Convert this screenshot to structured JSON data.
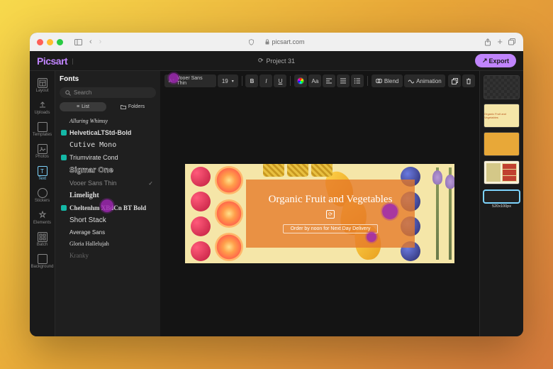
{
  "browser": {
    "url": "picsart.com"
  },
  "app": {
    "logo": "Picsart",
    "project_name": "Project 31",
    "export_label": "Export"
  },
  "rail": {
    "items": [
      {
        "label": "Layout"
      },
      {
        "label": "Uploads"
      },
      {
        "label": "Templates"
      },
      {
        "label": "Photos"
      },
      {
        "label": "Text"
      },
      {
        "label": "Stickers"
      },
      {
        "label": "Elements"
      },
      {
        "label": "Batch"
      },
      {
        "label": "Background"
      }
    ]
  },
  "fonts_panel": {
    "title": "Fonts",
    "search_placeholder": "Search",
    "tab_list": "List",
    "tab_folders": "Folders",
    "items": [
      {
        "name": "Alluring Whimsy",
        "style": "italic 8px cursive",
        "badged": false
      },
      {
        "name": "HelveticaLTStd-Bold",
        "style": "bold 9px sans-serif",
        "badged": true
      },
      {
        "name": "Cutive Mono",
        "style": "10px monospace",
        "badged": false
      },
      {
        "name": "Triumvirate Cond",
        "style": "9px sans-serif",
        "badged": true
      },
      {
        "name": "Sigmar One",
        "style": "bold 11px sans-serif",
        "badged": false,
        "outlined": true
      },
      {
        "name": "Vooer Sans Thin",
        "style": "100 9px sans-serif",
        "badged": false,
        "selected": true
      },
      {
        "name": "Limelight",
        "style": "bold 10px serif",
        "badged": false
      },
      {
        "name": "Cheltenhm XBdCn BT Bold",
        "style": "bold 9px serif",
        "badged": true
      },
      {
        "name": "Short Stack",
        "style": "10px sans-serif",
        "badged": false
      },
      {
        "name": "Average Sans",
        "style": "8px sans-serif",
        "badged": false
      },
      {
        "name": "Gloria Hallelujah",
        "style": "8px cursive",
        "badged": false
      },
      {
        "name": "Kranky",
        "style": "9px serif",
        "badged": false,
        "dim": true
      }
    ]
  },
  "toolbar": {
    "font_label": "Vooer Sans Thin",
    "font_size": "19",
    "blend_label": "Blend",
    "animation_label": "Animation"
  },
  "canvas": {
    "headline": "Organic Fruit and Vegetables",
    "subline": "Order by noon for Next Day Delivery"
  },
  "thumbs": {
    "t2_label": "Organic Fruit and Vegetables",
    "selected_dims": "520x100px"
  }
}
